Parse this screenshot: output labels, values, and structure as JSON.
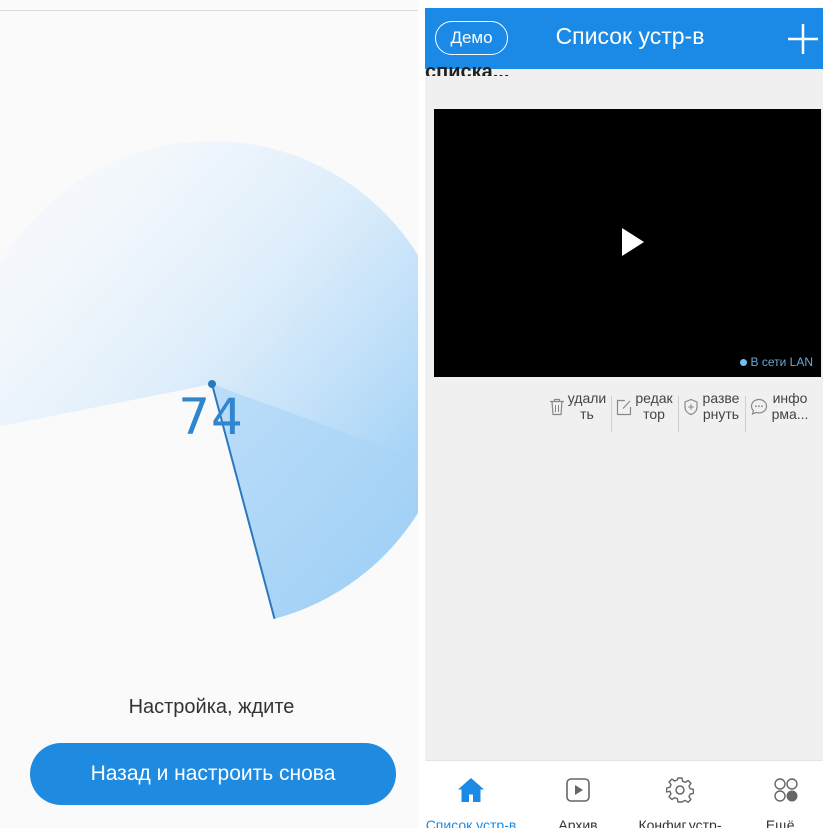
{
  "setup_screen": {
    "progress_value": "74",
    "progress_percent": 74,
    "status_text": "Настройка, ждите",
    "retry_button_label": "Назад и настроить снова",
    "colors": {
      "accent": "#1e8ae0",
      "progress_text": "#2f86cf",
      "sweep": "#90c8f4"
    }
  },
  "device_list": {
    "header": {
      "demo_label": "Демо",
      "title": "Список устр-в",
      "add_icon": "plus-icon"
    },
    "list_title_fragment": "списка...",
    "device": {
      "lan_status": "В сети LAN",
      "play_icon": "play-icon"
    },
    "actions": [
      {
        "label": "удали\nть",
        "icon": "trash-icon"
      },
      {
        "label": "редак\nтор",
        "icon": "edit-icon"
      },
      {
        "label": "разве\nрнуть",
        "icon": "shield-icon"
      },
      {
        "label": "инфо\nрма...",
        "icon": "message-icon"
      }
    ],
    "bottom_nav": [
      {
        "label": "Список устр-в",
        "icon": "home-icon",
        "active": true
      },
      {
        "label": "Архив",
        "icon": "play-square-icon",
        "active": false
      },
      {
        "label": "Конфиг.устр-",
        "icon": "gear-icon",
        "active": false
      },
      {
        "label": "Ещё...",
        "icon": "more-dots-icon",
        "active": false
      }
    ],
    "colors": {
      "header": "#1a8ae6",
      "active_nav": "#1a8ae6"
    }
  }
}
